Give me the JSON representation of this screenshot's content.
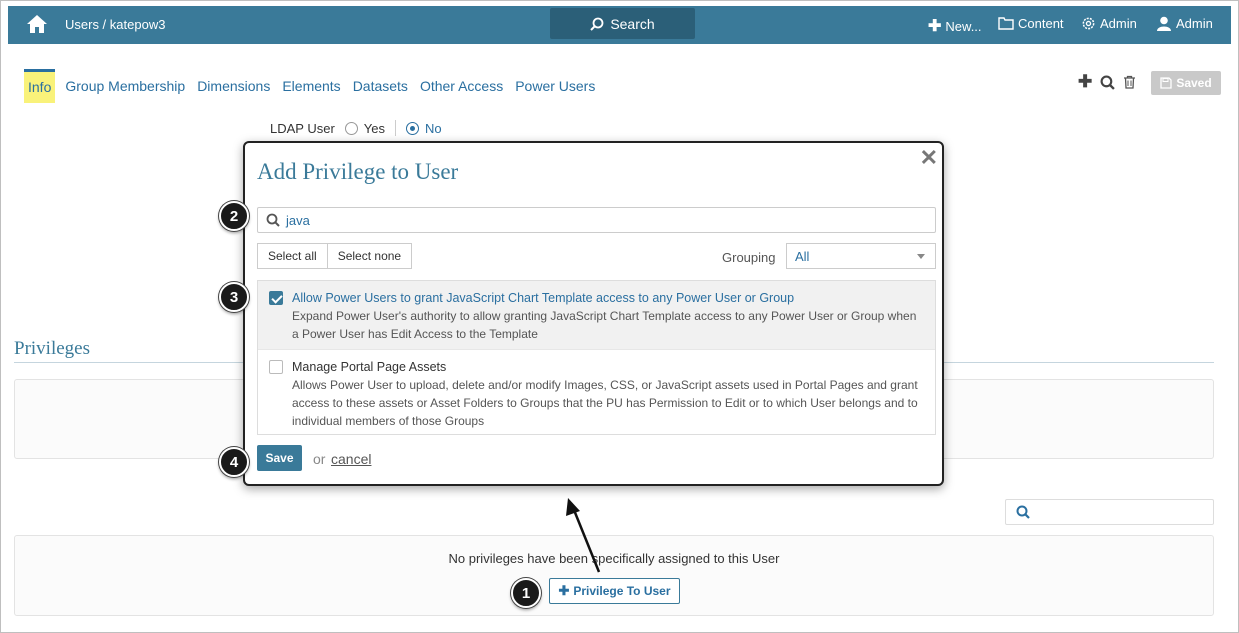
{
  "topbar": {
    "breadcrumb": "Users / katepow3",
    "search_label": "Search",
    "new_label": "New...",
    "content_label": "Content",
    "admin_label": "Admin",
    "user_label": "Admin"
  },
  "tabs": [
    "Info",
    "Group Membership",
    "Dimensions",
    "Elements",
    "Datasets",
    "Other Access",
    "Power Users"
  ],
  "toolbar": {
    "saved_label": "Saved"
  },
  "form": {
    "ldap_label": "LDAP User",
    "ldap_yes": "Yes",
    "ldap_no": "No",
    "ldap_selected": "No"
  },
  "privileges": {
    "heading": "Privileges",
    "empty_text": "No privileges have been specifically assigned to this User",
    "add_button": "Privilege To User"
  },
  "modal": {
    "title": "Add Privilege to User",
    "search_value": "java",
    "select_all": "Select all",
    "select_none": "Select none",
    "grouping_label": "Grouping",
    "grouping_value": "All",
    "items": [
      {
        "title": "Allow Power Users to grant JavaScript Chart Template access to any Power User or Group",
        "desc": "Expand Power User's authority to allow granting JavaScript Chart Template access to any Power User or Group when a Power User has Edit Access to the Template",
        "checked": true
      },
      {
        "title": "Manage Portal Page Assets",
        "desc": "Allows Power User to upload, delete and/or modify Images, CSS, or JavaScript assets used in Portal Pages and grant access to these assets or Asset Folders to Groups that the PU has Permission to Edit or to which User belongs and to individual members of those Groups",
        "checked": false
      }
    ],
    "save_label": "Save",
    "or_text": "or",
    "cancel_label": "cancel"
  },
  "callouts": [
    "1",
    "2",
    "3",
    "4"
  ],
  "colors": {
    "brand": "#3a7a99",
    "link": "#2a6fa0",
    "active_tab": "#f9f27a"
  }
}
